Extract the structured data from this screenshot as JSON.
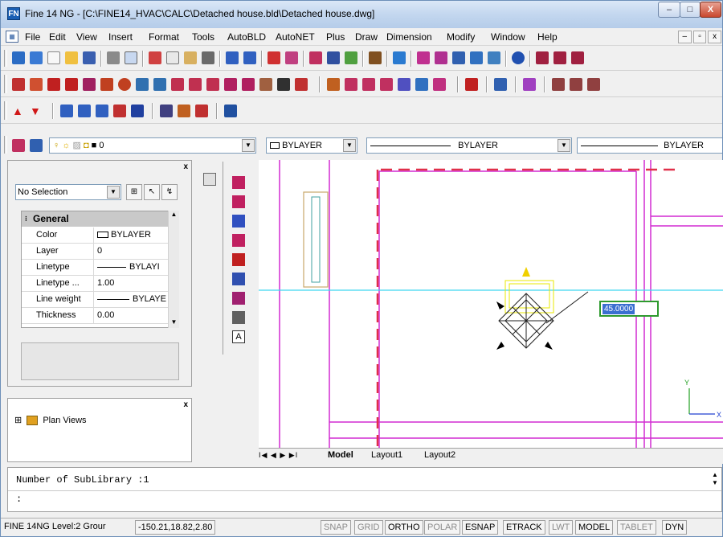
{
  "window": {
    "title": "Fine 14 NG  - [C:\\FINE14_HVAC\\CALC\\Detached house.bld\\Detached house.dwg]",
    "app_icon": "FN",
    "min_glyph": "–",
    "max_glyph": "□",
    "close_glyph": "X"
  },
  "menu": {
    "items": [
      "File",
      "Edit",
      "View",
      "Insert",
      "Format",
      "Tools",
      "AutoBLD",
      "AutoNET",
      "Plus",
      "Draw",
      "Dimension",
      "Modify",
      "Window",
      "Help"
    ],
    "mdi": [
      "–",
      "▫",
      "x"
    ]
  },
  "layer_row": {
    "layer_name": "0",
    "color_value": "BYLAYER",
    "linetype_value": "BYLAYER",
    "lineweight_value": "BYLAYER"
  },
  "properties_panel": {
    "close_glyph": "x",
    "selection": "No Selection",
    "section_title": "General",
    "rows": [
      {
        "key": "Color",
        "value": "BYLAYER"
      },
      {
        "key": "Layer",
        "value": "0"
      },
      {
        "key": "Linetype",
        "value": "BYLAYI"
      },
      {
        "key": "Linetype ...",
        "value": "1.00"
      },
      {
        "key": "Line weight",
        "value": "BYLAYE"
      },
      {
        "key": "Thickness",
        "value": "0.00"
      }
    ]
  },
  "tree_panel": {
    "close_glyph": "x",
    "expander": "⊞",
    "item": "Plan Views"
  },
  "canvas": {
    "dynamic_input_value": "45.0000"
  },
  "layout_tabs": {
    "nav": "I◀ ◀ ▶ ▶I",
    "tabs": [
      "Model",
      "Layout1",
      "Layout2"
    ],
    "active": "Model"
  },
  "command": {
    "history": "Number of SubLibrary :1",
    "prompt": ":"
  },
  "status": {
    "app_level": "FINE 14NG Level:2 Grour",
    "coords": "-150.21,18.82,2.80",
    "buttons": [
      {
        "label": "SNAP",
        "state": "off"
      },
      {
        "label": "GRID",
        "state": "off"
      },
      {
        "label": "ORTHO",
        "state": "on"
      },
      {
        "label": "POLAR",
        "state": "off"
      },
      {
        "label": "ESNAP",
        "state": "on"
      },
      {
        "label": "ETRACK",
        "state": "on"
      },
      {
        "label": "LWT",
        "state": "off"
      },
      {
        "label": "MODEL",
        "state": "on"
      },
      {
        "label": "TABLET",
        "state": "off"
      },
      {
        "label": "DYN",
        "state": "on"
      }
    ]
  },
  "colors": {
    "wall_magenta": "#d22bd2",
    "crosshair_cyan": "#3fd6f0",
    "dashed_red": "#e0304a",
    "input_green": "#2e9a2e"
  }
}
